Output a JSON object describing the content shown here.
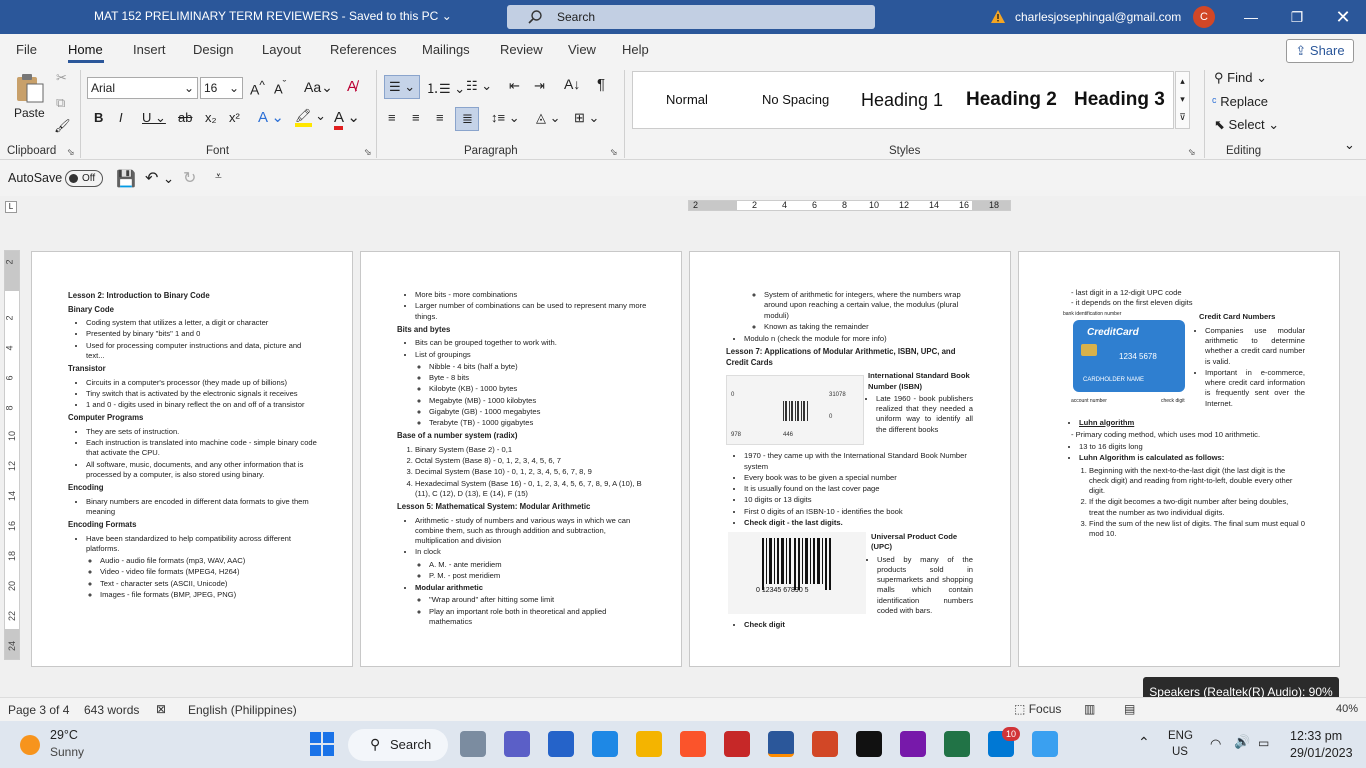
{
  "titlebar": {
    "doc_title": "MAT 152 PRELIMINARY TERM REVIEWERS  -  Saved to this PC",
    "search_label": "Search",
    "user_email": "charlesjosephingal@gmail.com",
    "avatar_letter": "C"
  },
  "menu": {
    "tabs": [
      "File",
      "Home",
      "Insert",
      "Design",
      "Layout",
      "References",
      "Mailings",
      "Review",
      "View",
      "Help"
    ],
    "share_label": "Share"
  },
  "ribbon": {
    "paste_label": "Paste",
    "font_name": "Arial",
    "font_size": "16",
    "style_normal": "Normal",
    "style_no_spacing": "No Spacing",
    "style_h1": "Heading 1",
    "style_h2": "Heading 2",
    "style_h3": "Heading 3",
    "find_label": "Find",
    "replace_label": "Replace",
    "select_label": "Select",
    "group_clipboard": "Clipboard",
    "group_font": "Font",
    "group_paragraph": "Paragraph",
    "group_styles": "Styles",
    "group_editing": "Editing"
  },
  "qat": {
    "autosave_label": "AutoSave",
    "autosave_state": "Off"
  },
  "ruler_labels": [
    "2",
    "2",
    "4",
    "6",
    "8",
    "10",
    "12",
    "14",
    "16",
    "18"
  ],
  "vruler_labels": [
    "2",
    "2",
    "4",
    "6",
    "8",
    "10",
    "12",
    "14",
    "16",
    "18",
    "20",
    "22",
    "24"
  ],
  "page1": {
    "lesson_title": "Lesson 2: Introduction to Binary Code",
    "binary_code_title": "Binary Code",
    "binary_code_items": [
      "Coding system that utilizes a letter, a digit or character",
      "Presented by binary \"bits\" 1 and 0",
      "Used for processing computer instructions and data, picture and text..."
    ],
    "transistor_title": "Transistor",
    "transistor_items": [
      "Circuits in a computer's processor (they made up of billions)",
      "Tiny switch that is activated by the electronic signals it receives",
      "1 and 0 - digits used in binary reflect the on and off of a transistor"
    ],
    "programs_title": "Computer Programs",
    "programs_items": [
      "They are sets of instruction.",
      "Each instruction is translated into machine code - simple binary code that activate the CPU.",
      "All software, music, documents, and any other information that is processed by a computer, is also stored using binary."
    ],
    "encoding_title": "Encoding",
    "encoding_items": [
      "Binary numbers are encoded in different data formats to give them meaning"
    ],
    "formats_title": "Encoding Formats",
    "formats_items": [
      "Have been standardized to help compatibility across different platforms."
    ],
    "formats_sub": [
      "Audio - audio file formats (mp3, WAV, AAC)",
      "Video - video file formats (MPEG4, H264)",
      "Text - character sets (ASCII, Unicode)",
      "Images - file formats (BMP, JPEG, PNG)"
    ]
  },
  "page2": {
    "top_items": [
      "More bits - more combinations",
      "Larger number of combinations can be used to represent many more things."
    ],
    "bytes_title": "Bits and bytes",
    "bytes_items": [
      "Bits can be grouped together to work with.",
      "List of groupings"
    ],
    "groupings": [
      "Nibble - 4 bits (half a byte)",
      "Byte - 8 bits",
      "Kilobyte (KB) - 1000 bytes",
      "Megabyte (MB) - 1000 kilobytes",
      "Gigabyte (GB) - 1000 megabytes",
      "Terabyte (TB) - 1000 gigabytes"
    ],
    "base_title": "Base of a number system (radix)",
    "base_items": [
      "Binary System (Base 2) - 0,1",
      "Octal System (Base 8) - 0, 1, 2, 3, 4, 5, 6, 7",
      "Decimal System (Base 10) - 0, 1, 2, 3, 4, 5, 6, 7, 8, 9",
      "Hexadecimal System (Base 16) - 0, 1, 2, 3, 4, 5, 6, 7, 8, 9, A (10), B (11), C (12), D (13), E (14), F (15)"
    ],
    "lesson5_title": "Lesson 5: Mathematical System: Modular Arithmetic",
    "lesson5_items": [
      "Arithmetic - study of numbers and various ways in which we can combine them, such as through addition and subtraction, multiplication and division",
      "In clock"
    ],
    "clock_sub": [
      "A. M. - ante meridiem",
      "P. M. - post meridiem"
    ],
    "modular_item": "Modular arithmetic",
    "modular_sub": [
      "\"Wrap around\" after hitting some limit",
      "Play an important role both in theoretical and applied mathematics"
    ]
  },
  "page3": {
    "top_sub": [
      "System of arithmetic for integers, where the numbers wrap around upon reaching a certain value, the modulus (plural moduli)",
      "Known as taking the remainder"
    ],
    "modulo_item": "Modulo n (check the module for more info)",
    "lesson7_title": "Lesson 7: Applications of Modular Arithmetic, ISBN, UPC, and Credit Cards",
    "isbn_title": "International Standard Book Number (ISBN)",
    "isbn_late": "Late 1960 - book publishers realized that they needed a uniform way to identify all the different books",
    "isbn_numbers": [
      "978",
      "446",
      "31078",
      "0"
    ],
    "isbn_items": [
      "1970 - they came up with the International Standard Book Number system",
      "Every book was to be given a special number",
      "It is usually found on the last cover page",
      "10 digits or 13 digits",
      "First 0 digits of an ISBN-10 - identifies the book",
      "Check digit - the last digits."
    ],
    "upc_title": "Universal Product Code (UPC)",
    "upc_text": "Used by many of the products sold in supermarkets and shopping malls which contain identification numbers coded with bars.",
    "upc_barcode_number": "0 12345 67890 5",
    "check_digit": "Check digit"
  },
  "page4": {
    "top_items": [
      "last digit in a 12-digit UPC code",
      "it depends on the first eleven digits"
    ],
    "card_caption_top": "bank identification number",
    "card_brand": "CreditCard",
    "card_number": "1234 5678",
    "card_holder": "CARDHOLDER NAME",
    "card_caption_left": "account number",
    "card_caption_right": "check digit",
    "cc_title": "Credit Card Numbers",
    "cc_items": [
      "Companies use modular arithmetic to determine whether a credit card number is valid.",
      "Important in e-commerce, where credit card information is frequently sent over the Internet."
    ],
    "luhn_title": "Luhn algorithm",
    "luhn_sub": [
      "Primary coding method, which uses mod 10 arithmetic."
    ],
    "luhn_len": "13 to 16 digits long",
    "luhn_calc": "Luhn Algorithm is calculated as follows:",
    "luhn_steps": [
      "Beginning with the next-to-the-last digit (the last digit is the check digit) and reading from right-to-left, double every other digit.",
      "If the digit becomes a two-digit number after being doubles, treat the number as two individual digits.",
      "Find the sum of the new list of digits. The final sum must equal 0 mod 10."
    ]
  },
  "status": {
    "page": "Page 3 of 4",
    "words": "643 words",
    "language": "English (Philippines)",
    "focus": "Focus",
    "zoom": "40%"
  },
  "toast": "Speakers (Realtek(R) Audio): 90%",
  "taskbar": {
    "temp": "29°C",
    "weather": "Sunny",
    "search_label": "Search",
    "lang1": "ENG",
    "lang2": "US",
    "time": "12:33 pm",
    "date": "29/01/2023",
    "badge": "10"
  }
}
